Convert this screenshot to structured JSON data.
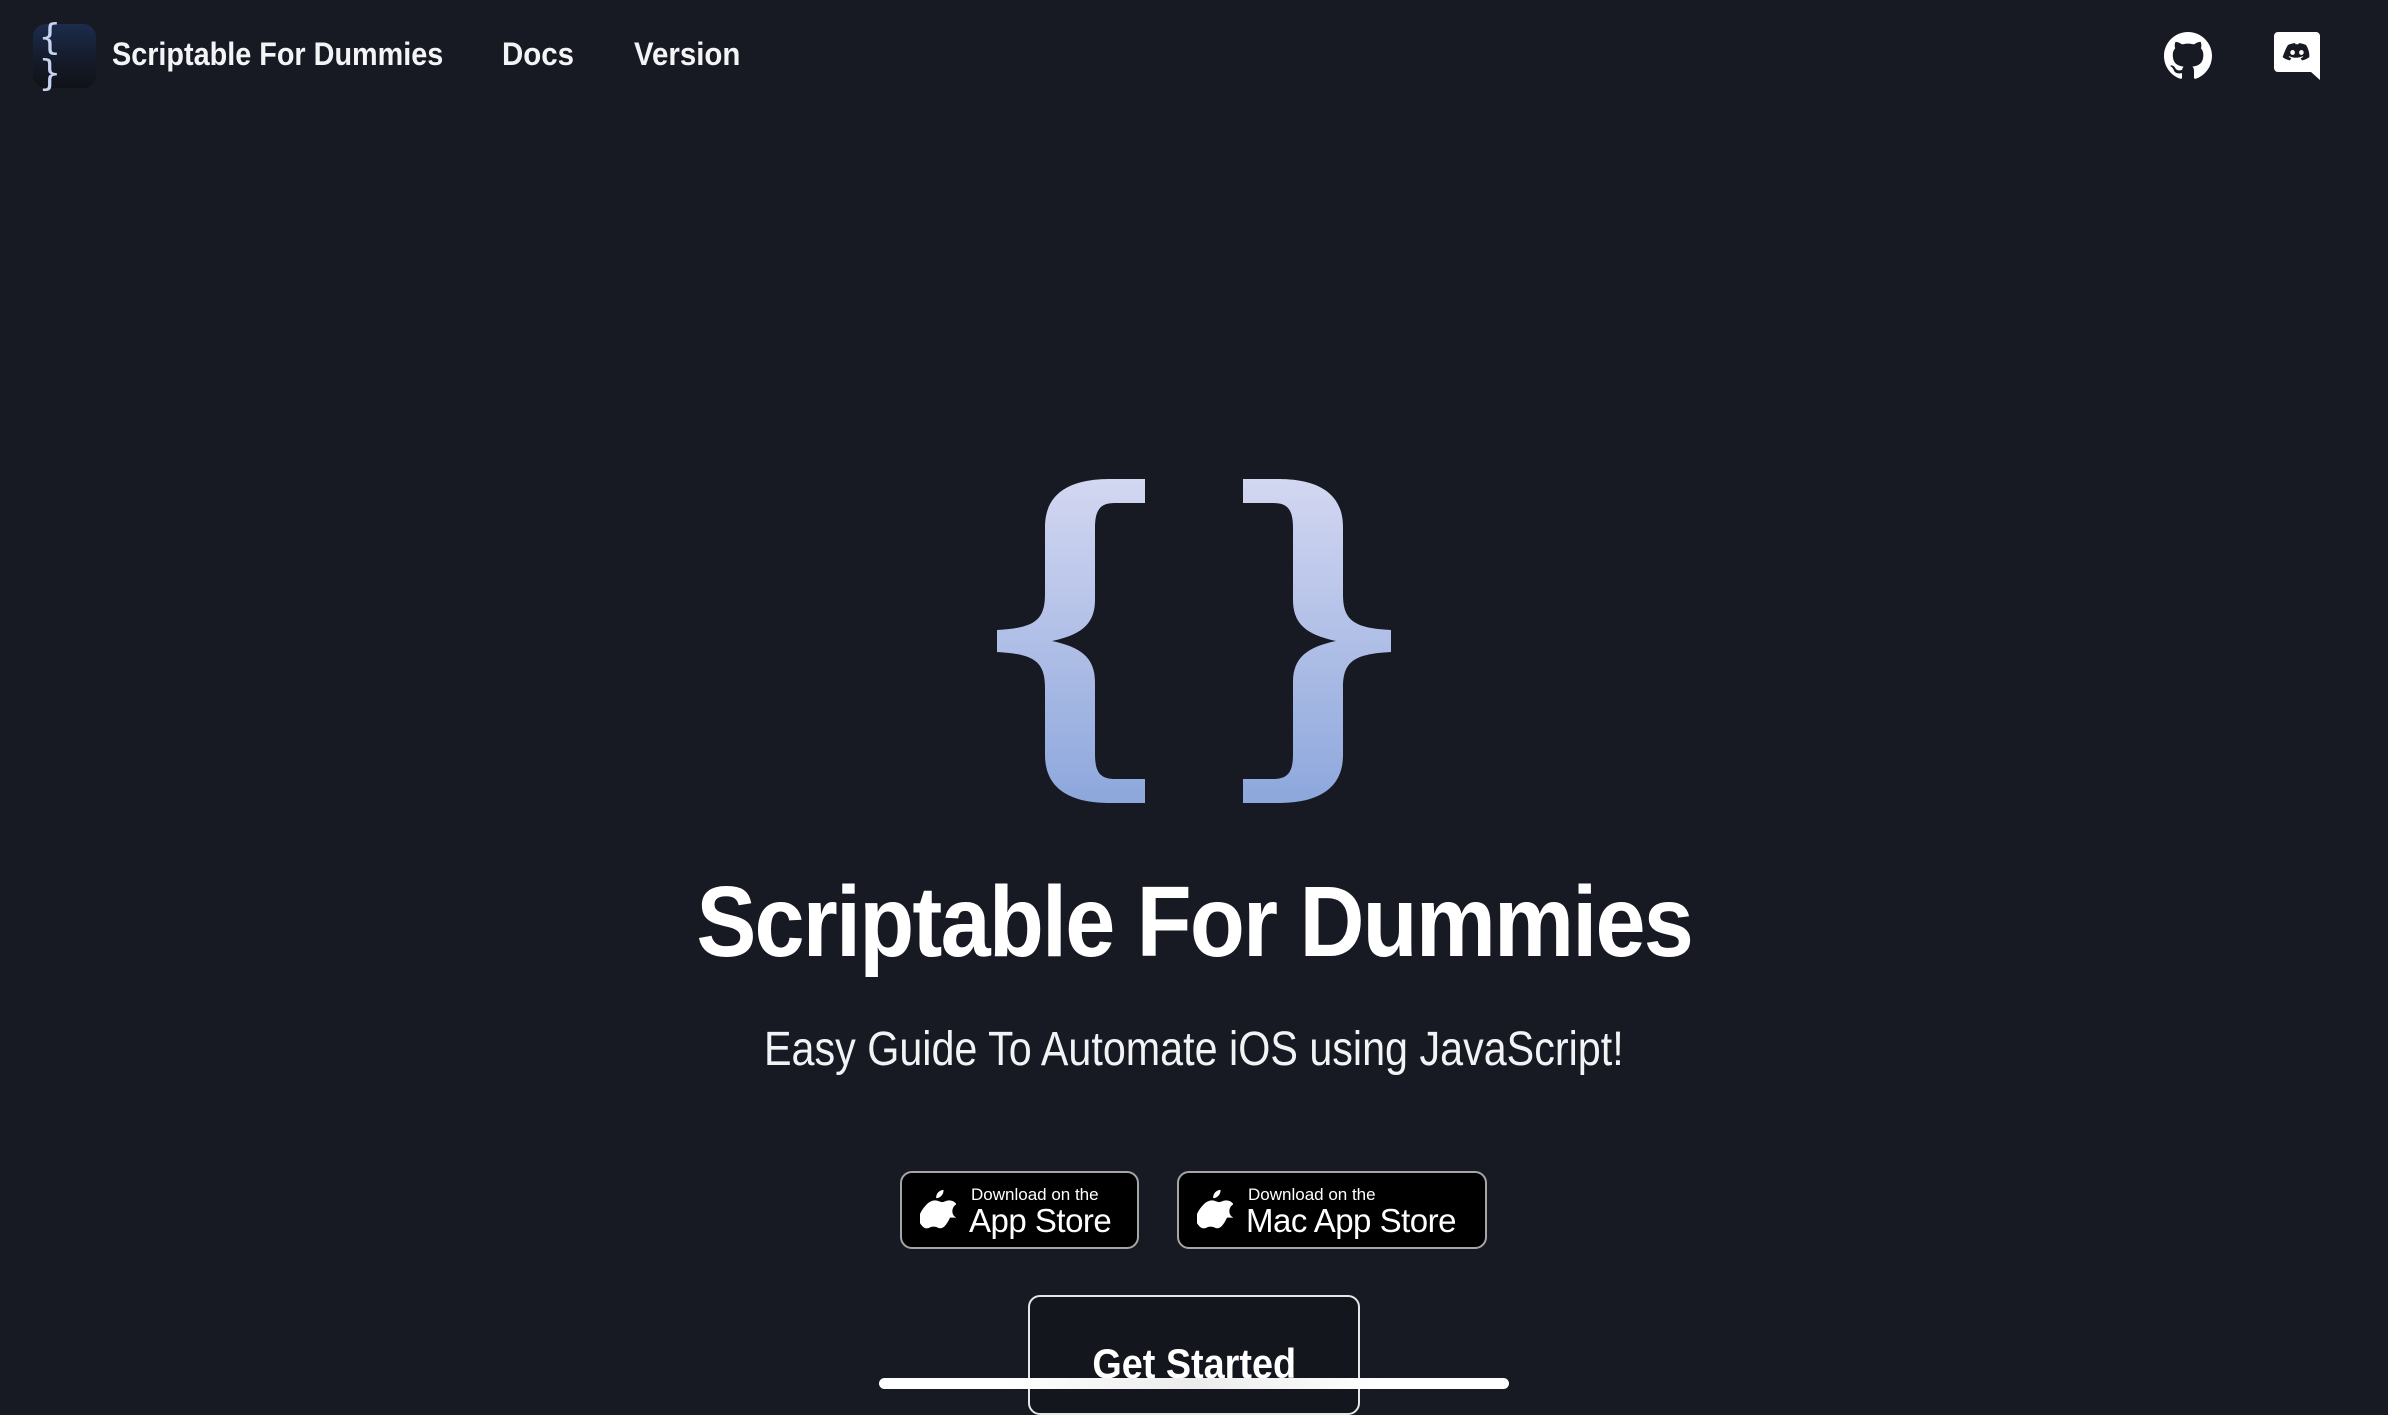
{
  "navbar": {
    "logo_glyph": "{ }",
    "brand": "Scriptable For Dummies",
    "links": [
      {
        "label": "Docs"
      },
      {
        "label": "Version"
      }
    ],
    "icons": [
      "github-icon",
      "discord-icon"
    ]
  },
  "hero": {
    "logo": "curly-braces-logo",
    "title": "Scriptable For Dummies",
    "subtitle": "Easy Guide To Automate iOS using JavaScript!",
    "badges": [
      {
        "small": "Download on the",
        "big": "App Store",
        "icon": "apple-icon"
      },
      {
        "small": "Download on the",
        "big": "Mac App Store",
        "icon": "apple-icon"
      }
    ],
    "cta_label": "Get Started"
  },
  "colors": {
    "background": "#171a23",
    "brace_top": "#d3d7f1",
    "brace_bottom": "#8da7dc",
    "text": "#ffffff"
  }
}
